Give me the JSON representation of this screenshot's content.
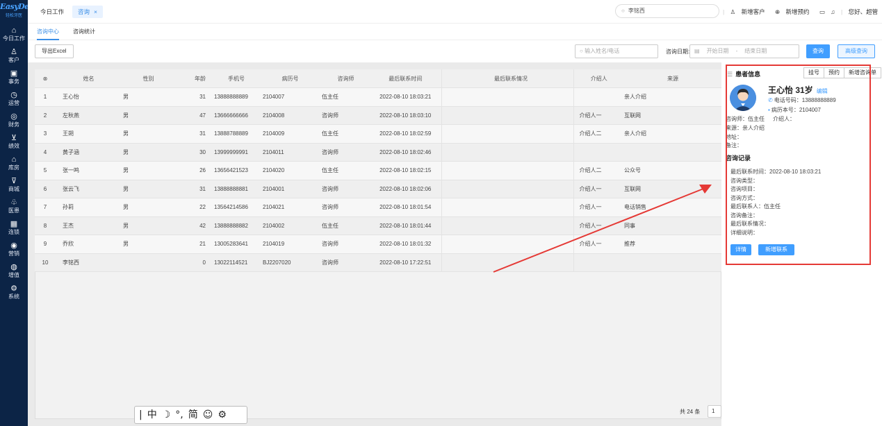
{
  "logo": {
    "brand": "EasyDent",
    "sub": "轻松牙医"
  },
  "sidebar": {
    "items": [
      {
        "label": "今日工作",
        "icon": "home-icon"
      },
      {
        "label": "客户",
        "icon": "customer-icon"
      },
      {
        "label": "事务",
        "icon": "task-icon"
      },
      {
        "label": "运营",
        "icon": "operations-icon"
      },
      {
        "label": "财务",
        "icon": "finance-icon"
      },
      {
        "label": "绩效",
        "icon": "performance-icon"
      },
      {
        "label": "库房",
        "icon": "warehouse-icon"
      },
      {
        "label": "商城",
        "icon": "mall-icon"
      },
      {
        "label": "医患",
        "icon": "doctor-patient-icon"
      },
      {
        "label": "连锁",
        "icon": "chain-icon"
      },
      {
        "label": "营销",
        "icon": "marketing-icon"
      },
      {
        "label": "增值",
        "icon": "value-added-icon"
      },
      {
        "label": "系统",
        "icon": "system-icon"
      }
    ]
  },
  "topbar": {
    "tabs": [
      {
        "label": "今日工作"
      },
      {
        "label": "咨询",
        "close": "×"
      }
    ],
    "search_value": "李铭西",
    "new_customer": "新增客户",
    "new_appointment": "新增预约",
    "greeting": "您好、超管"
  },
  "subtabs": [
    {
      "label": "咨询中心"
    },
    {
      "label": "咨询统计"
    }
  ],
  "toolbar": {
    "export_label": "导出Excel",
    "name_placeholder": "输入姓名/电话",
    "date_label": "咨询日期:",
    "start_placeholder": "开始日期",
    "range_sep": "-",
    "end_placeholder": "结束日期",
    "query_label": "查询",
    "advanced_label": "高级查询"
  },
  "table": {
    "headers": [
      "⊗",
      "姓名",
      "性别",
      "年龄",
      "手机号",
      "病历号",
      "咨询师",
      "最后联系时间",
      "最后联系情况",
      "介绍人",
      "来源"
    ],
    "rows": [
      [
        "1",
        "王心怡",
        "男",
        "31",
        "13888888889",
        "2104007",
        "伍主任",
        "2022-08-10 18:03:21",
        "",
        "",
        "亲人介绍"
      ],
      [
        "2",
        "左秋燕",
        "男",
        "47",
        "13666666666",
        "2104008",
        "咨询师",
        "2022-08-10 18:03:10",
        "",
        "介绍人一",
        "互联网"
      ],
      [
        "3",
        "王朔",
        "男",
        "31",
        "13888788889",
        "2104009",
        "伍主任",
        "2022-08-10 18:02:59",
        "",
        "介绍人二",
        "亲人介绍"
      ],
      [
        "4",
        "黄子涵",
        "男",
        "30",
        "13999999991",
        "2104011",
        "咨询师",
        "2022-08-10 18:02:46",
        "",
        "",
        ""
      ],
      [
        "5",
        "张一鸣",
        "男",
        "26",
        "13656421523",
        "2104020",
        "伍主任",
        "2022-08-10 18:02:15",
        "",
        "介绍人二",
        "公众号"
      ],
      [
        "6",
        "张云飞",
        "男",
        "31",
        "13888888881",
        "2104001",
        "咨询师",
        "2022-08-10 18:02:06",
        "",
        "介绍人一",
        "互联网"
      ],
      [
        "7",
        "孙莉",
        "男",
        "22",
        "13564214586",
        "2104021",
        "咨询师",
        "2022-08-10 18:01:54",
        "",
        "介绍人一",
        "电话销售"
      ],
      [
        "8",
        "王杰",
        "男",
        "42",
        "13888888882",
        "2104002",
        "伍主任",
        "2022-08-10 18:01:44",
        "",
        "介绍人一",
        "同事"
      ],
      [
        "9",
        "乔欣",
        "男",
        "21",
        "13005283641",
        "2104019",
        "咨询师",
        "2022-08-10 18:01:32",
        "",
        "介绍人一",
        "推荐"
      ],
      [
        "10",
        "李铭西",
        "",
        "0",
        "13022114521",
        "BJ2207020",
        "咨询师",
        "2022-08-10 17:22:51",
        "",
        "",
        ""
      ]
    ]
  },
  "pager": {
    "total": "共 24 条",
    "page": "1"
  },
  "ime": {
    "items": [
      "|",
      "中",
      "☽",
      "°,",
      "简",
      "☺",
      "⚙"
    ]
  },
  "panel": {
    "title": "患者信息",
    "buttons": [
      "挂号",
      "预约",
      "新增咨询单"
    ],
    "name_age": "王心怡 31岁",
    "edit": "编辑",
    "phone": "电话号码：13888888889",
    "record": "病历本号：2104007",
    "consultant": "咨询师：伍主任",
    "introducer": "介绍人：",
    "source": "来源：亲人介绍",
    "address": "地址：",
    "remark": "备注：",
    "records_title": "咨询记录",
    "record_lines": [
      "最后联系时间：2022-08-10 18:03:21",
      "咨询类型：",
      "咨询项目：",
      "咨询方式：",
      "最后联系人：伍主任",
      "咨询备注：",
      "最后联系情况：",
      "详细说明："
    ],
    "detail_btn": "详情",
    "add_contact_btn": "新增联系"
  },
  "colors": {
    "sidebar": "#0c2446",
    "accent": "#409eff",
    "highlight": "#e53935"
  }
}
